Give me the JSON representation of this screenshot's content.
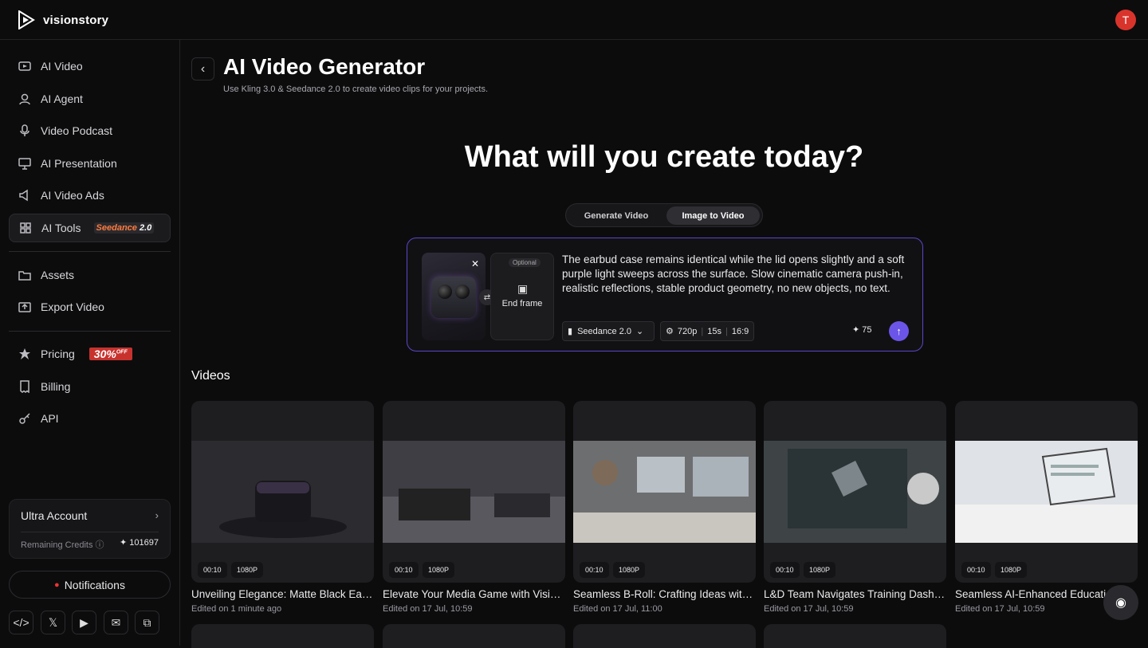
{
  "app": {
    "name": "visionstory",
    "avatar_letter": "T"
  },
  "sidebar": {
    "items": [
      {
        "label": "AI Video",
        "icon": "video-icon"
      },
      {
        "label": "AI Agent",
        "icon": "agent-icon"
      },
      {
        "label": "Video Podcast",
        "icon": "podcast-icon"
      },
      {
        "label": "AI Presentation",
        "icon": "presentation-icon"
      },
      {
        "label": "AI Video Ads",
        "icon": "ads-icon"
      },
      {
        "label": "AI Tools",
        "icon": "tools-icon",
        "badge": "Seedance",
        "badge_version": "2.0"
      }
    ],
    "items2": [
      {
        "label": "Assets",
        "icon": "assets-icon"
      },
      {
        "label": "Export Video",
        "icon": "export-icon"
      }
    ],
    "items3": [
      {
        "label": "Pricing",
        "icon": "pricing-icon",
        "badge": "30%",
        "badge_sub": "OFF"
      },
      {
        "label": "Billing",
        "icon": "billing-icon"
      },
      {
        "label": "API",
        "icon": "api-icon"
      }
    ],
    "account": {
      "title": "Ultra Account",
      "credits_label": "Remaining Credits",
      "credits": "101697"
    },
    "notifications": "Notifications"
  },
  "header": {
    "title": "AI Video Generator",
    "subtitle": "Use Kling 3.0 & Seedance 2.0 to create video clips for your projects."
  },
  "hero": "What will you create today?",
  "tabs": [
    {
      "label": "Generate Video",
      "active": false
    },
    {
      "label": "Image to Video",
      "active": true
    }
  ],
  "prompt": {
    "optional": "Optional",
    "end_frame": "End frame",
    "text": "The earbud case remains identical while the lid opens slightly and a soft purple light sweeps across the surface. Slow cinematic camera push-in, realistic reflections, stable product geometry, no new objects, no text.",
    "model": "Seedance 2.0",
    "resolution": "720p",
    "duration": "15s",
    "ratio": "16:9",
    "cost": "75"
  },
  "videos_heading": "Videos",
  "videos": [
    {
      "title": "Unveiling Elegance: Matte Black Earbuds",
      "date": "Edited on 1 minute ago",
      "duration": "00:10",
      "quality": "1080P"
    },
    {
      "title": "Elevate Your Media Game with VisionStory",
      "date": "Edited on 17 Jul, 10:59",
      "duration": "00:10",
      "quality": "1080P"
    },
    {
      "title": "Seamless B-Roll: Crafting Ideas with AI",
      "date": "Edited on 17 Jul, 11:00",
      "duration": "00:10",
      "quality": "1080P"
    },
    {
      "title": "L&D Team Navigates Training Dashboard",
      "date": "Edited on 17 Jul, 10:59",
      "duration": "00:10",
      "quality": "1080P"
    },
    {
      "title": "Seamless AI-Enhanced Education",
      "date": "Edited on 17 Jul, 10:59",
      "duration": "00:10",
      "quality": "1080P"
    }
  ]
}
